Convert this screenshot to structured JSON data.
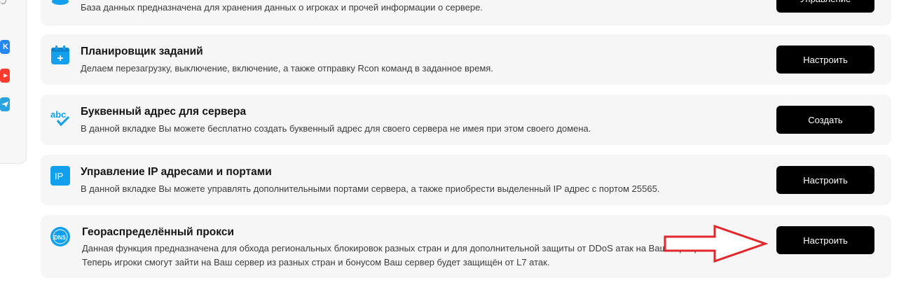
{
  "sidebar": {
    "icons": [
      {
        "name": "vk-icon",
        "text": "K",
        "color": "#2787f5"
      },
      {
        "name": "youtube-icon",
        "text": "",
        "color": "#ff3b30"
      },
      {
        "name": "telegram-icon",
        "text": "",
        "color": "#2aa3df"
      }
    ]
  },
  "cards": [
    {
      "title": "",
      "desc": "База данных предназначена для хранения данных о игроках и прочей информации о сервере.",
      "button": "Управление"
    },
    {
      "title": "Планировщик заданий",
      "desc": "Делаем перезагрузку, выключение, включение, а также отправку Rcon команд в заданное время.",
      "button": "Настроить"
    },
    {
      "title": "Буквенный адрес для сервера",
      "desc": "В данной вкладке Вы можете бесплатно создать буквенный адрес для своего сервера не имея при этом своего домена.",
      "button": "Создать"
    },
    {
      "title": "Управление IP адресами и портами",
      "desc": "В данной вкладке Вы можете управлять дополнительными портами сервера, а также приобрести выделенный IP адрес с портом 25565.",
      "button": "Настроить"
    },
    {
      "title": "Георaспределённый прокси",
      "desc1": "Данная функция предназначена для обхода региональных блокировок разных стран и для дополнительной защиты от DDoS атак на Ваш сервера.",
      "desc2": "Теперь игроки смогут зайти на Ваш сервер из разных стран и бонусом Ваш сервер будет защищён от L7 атак.",
      "button": "Настроить"
    }
  ],
  "icons": {
    "scheduler": "calendar-add-icon",
    "abc": "abc-check-icon",
    "ip": "IP",
    "dns": "DNS"
  },
  "colors": {
    "accent": "#12a0ee",
    "button_bg": "#000000",
    "card_bg": "#f6f6f7",
    "arrow": "#e3262b"
  }
}
